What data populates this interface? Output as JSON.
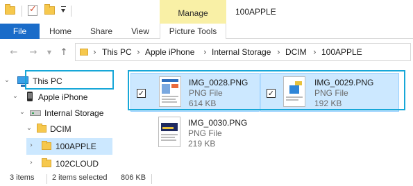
{
  "titlebar": {
    "manage_label": "Manage",
    "title": "100APPLE"
  },
  "ribbon": {
    "tabs": [
      {
        "label": "File"
      },
      {
        "label": "Home"
      },
      {
        "label": "Share"
      },
      {
        "label": "View"
      },
      {
        "label": "Picture Tools"
      }
    ]
  },
  "address": {
    "crumbs": [
      "This PC",
      "Apple iPhone",
      "Internal Storage",
      "DCIM",
      "100APPLE"
    ]
  },
  "navpane": {
    "items": [
      {
        "label": "This PC",
        "icon": "pc-icon"
      },
      {
        "label": "Apple iPhone",
        "icon": "phone-icon"
      },
      {
        "label": "Internal Storage",
        "icon": "drive-icon"
      },
      {
        "label": "DCIM",
        "icon": "folder-icon"
      },
      {
        "label": "100APPLE",
        "icon": "folder-icon"
      },
      {
        "label": "102CLOUD",
        "icon": "folder-icon"
      }
    ]
  },
  "files": [
    {
      "name": "IMG_0028.PNG",
      "type": "PNG File",
      "size": "614 KB",
      "selected": true
    },
    {
      "name": "IMG_0029.PNG",
      "type": "PNG File",
      "size": "192 KB",
      "selected": true
    },
    {
      "name": "IMG_0030.PNG",
      "type": "PNG File",
      "size": "219 KB",
      "selected": false
    }
  ],
  "status": {
    "count": "3 items",
    "selected": "2 items selected",
    "size": "806 KB"
  },
  "colors": {
    "file_tab": "#1a6cc9",
    "manage_context": "#f9f0a6",
    "selection": "#cce8ff",
    "highlight_border": "#17a7d8"
  }
}
